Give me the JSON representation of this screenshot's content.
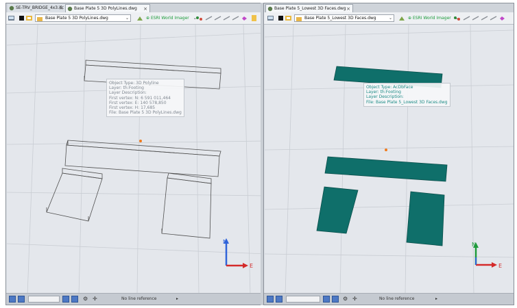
{
  "left_pane": {
    "tabs": [
      {
        "label": "SE-TRV_BRIDGE_4x3.ifc",
        "active": false
      },
      {
        "label": "Base Plate 5 3D PolyLines.dwg",
        "active": true
      }
    ],
    "toolbar": {
      "file_select": "Base Plate 5 3D PolyLines.dwg",
      "imagery": "ESRI World Imager"
    },
    "tooltip": {
      "lines": [
        "Object Type: 3D Polyline",
        "Layer: th:Footing",
        "Layer Description:",
        "First vertex: N: 6 591 011,464",
        "First vertex: E: 140 578,850",
        "First vertex: H: 17,685",
        "File: Base Plate 5 3D PolyLines.dwg"
      ]
    },
    "axes": {
      "north": "N",
      "east": "E"
    },
    "status": {
      "reference": "No line reference"
    }
  },
  "right_pane": {
    "tabs": [
      {
        "label": "Base Plate 5_Lowest 3D Faces.dwg",
        "active": true
      }
    ],
    "toolbar": {
      "file_select": "Base Plate 5_Lowest 3D Faces.dwg",
      "imagery": "ESRI World Imager"
    },
    "tooltip": {
      "lines": [
        "Object Type: AcDbFace",
        "Layer: th:Footing",
        "Layer Description:",
        "File: Base Plate 5_Lowest 3D Faces.dwg"
      ]
    },
    "axes": {
      "north": "N",
      "east": "E"
    },
    "status": {
      "reference": "No line reference"
    }
  },
  "colors": {
    "face_fill": "#0f6f6a",
    "face_stroke": "#0a4f4b",
    "polyline": "#4f4f4f",
    "grid": "#c9cdd3",
    "axis_east": "#d42a2a",
    "axis_north_left": "#2f63d9",
    "axis_north_right": "#1e9b3b",
    "axis_up": "#2f63d9",
    "tooltip_text_left": "#7f8790",
    "tooltip_text_right": "#1b8a84",
    "imagery_text": "#1a9a3a",
    "center_marker": "#f07a1c"
  }
}
